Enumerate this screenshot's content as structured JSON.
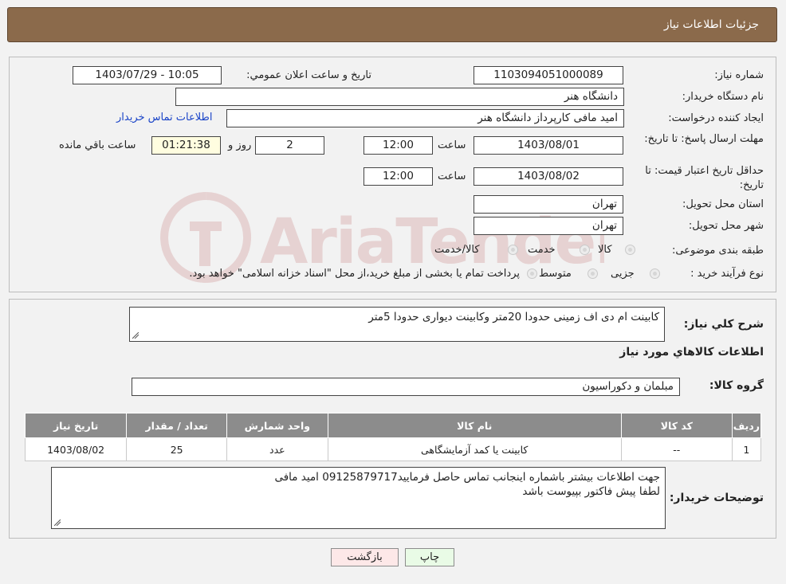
{
  "header": {
    "title": "جزئیات اطلاعات نیاز"
  },
  "form": {
    "need_number_label": "شماره نیاز:",
    "need_number": "1103094051000089",
    "announce_label": "تاریخ و ساعت اعلان عمومي:",
    "announce_value": "1403/07/29 - 10:05",
    "buyer_org_label": "نام دستگاه خریدار:",
    "buyer_org": "دانشگاه هنر",
    "creator_label": "ایجاد کننده درخواست:",
    "creator": "امید مافی کارپرداز دانشگاه هنر",
    "contact_link": "اطلاعات تماس خریدار",
    "reply_deadline_label": "مهلت ارسال پاسخ: تا تاریخ:",
    "reply_date": "1403/08/01",
    "time_label": "ساعت",
    "reply_time": "12:00",
    "days_value": "2",
    "days_label": "روز و",
    "remaining_time": "01:21:38",
    "remaining_label": "ساعت باقي مانده",
    "price_validity_label": "حداقل تاریخ اعتبار قیمت: تا تاریخ:",
    "price_date": "1403/08/02",
    "price_time": "12:00",
    "province_label": "استان محل تحویل:",
    "province": "تهران",
    "city_label": "شهر محل تحویل:",
    "city": "تهران",
    "category_label": "طبقه بندی موضوعی:",
    "category_options": [
      "کالا",
      "خدمت",
      "کالا/خدمت"
    ],
    "process_label": "نوع فرآیند خرید :",
    "process_options": [
      "جزیی",
      "متوسط"
    ],
    "payment_note": "پرداخت تمام یا بخشی از مبلغ خرید،از محل \"اسناد خزانه اسلامی\" خواهد بود."
  },
  "details": {
    "summary_label": "شرح کلي نیاز:",
    "summary": "کابینت ام دی اف زمینی حدودا 20متر وکابینت دیواری حدودا 5متر",
    "goods_info_title": "اطلاعات کالاهاي مورد نیاز",
    "goods_group_label": "گروه کالا:",
    "goods_group": "مبلمان و دکوراسیون",
    "table": {
      "headers": [
        "ردیف",
        "کد کالا",
        "نام کالا",
        "واحد شمارش",
        "تعداد / مقدار",
        "تاریخ نیاز"
      ],
      "rows": [
        [
          "1",
          "--",
          "کابینت یا کمد آزمایشگاهی",
          "عدد",
          "25",
          "1403/08/02"
        ]
      ]
    },
    "buyer_notes_label": "توضیحات خریدار:",
    "buyer_notes_line1": "جهت اطلاعات بیشتر باشماره اینجانب تماس حاصل فرمایید09125879717 امید مافی",
    "buyer_notes_line2": "لطفا پیش فاکتور بپیوست باشد"
  },
  "buttons": {
    "print": "چاپ",
    "back": "بازگشت"
  },
  "watermark_text": "AriaTender.neT"
}
